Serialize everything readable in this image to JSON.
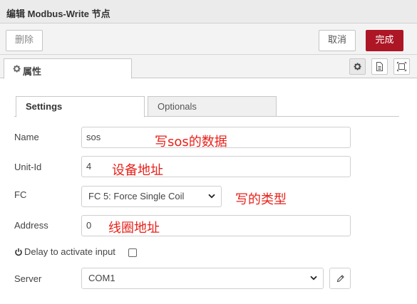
{
  "dialog": {
    "title": "编辑 Modbus-Write 节点"
  },
  "toolbar": {
    "delete_label": "删除",
    "cancel_label": "取消",
    "done_label": "完成"
  },
  "properties_tab": {
    "label": "属性",
    "icon": "gear-icon"
  },
  "header_icons": [
    "gear-icon",
    "document-icon",
    "frame-icon"
  ],
  "tabs": [
    {
      "label": "Settings",
      "active": true
    },
    {
      "label": "Optionals",
      "active": false
    }
  ],
  "form": {
    "name": {
      "label": "Name",
      "value": "sos",
      "annotation": "写sos的数据"
    },
    "unit_id": {
      "label": "Unit-Id",
      "value": "4",
      "annotation": "设备地址"
    },
    "fc": {
      "label": "FC",
      "value": "FC 5: Force Single Coil",
      "annotation": "写的类型"
    },
    "address": {
      "label": "Address",
      "value": "0",
      "annotation": "线圈地址"
    },
    "delay": {
      "label": "Delay to activate input",
      "checked": false,
      "icon": "power-icon"
    },
    "server": {
      "label": "Server",
      "value": "COM1"
    }
  },
  "colors": {
    "accent": "#ad1625",
    "annotation": "#e8211a"
  }
}
